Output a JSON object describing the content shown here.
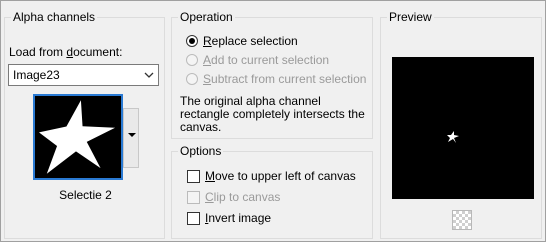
{
  "alpha": {
    "legend": "Alpha channels",
    "load_label_prefix": "Load from ",
    "load_label_underline": "d",
    "load_label_suffix": "ocument:",
    "document_value": "Image23",
    "thumbnail_caption": "Selectie 2"
  },
  "operation": {
    "legend": "Operation",
    "replace": {
      "underline": "R",
      "rest": "eplace selection"
    },
    "add": {
      "underline": "A",
      "rest": "dd to current selection"
    },
    "subtract": {
      "underline": "S",
      "rest": "ubtract from current selection"
    },
    "note": "The original alpha channel rectangle completely intersects the canvas."
  },
  "options": {
    "legend": "Options",
    "move": {
      "underline": "M",
      "rest": "ove to upper left of canvas"
    },
    "clip": {
      "underline": "C",
      "rest": "lip to canvas"
    },
    "invert": {
      "underline": "I",
      "rest": "nvert image"
    }
  },
  "preview": {
    "legend": "Preview"
  },
  "colors": {
    "selection_border": "#2a7ad3",
    "disabled_text": "#9a9a9a"
  },
  "icons": [
    "chevron-down-icon",
    "star-icon",
    "transparency-checker-icon"
  ]
}
